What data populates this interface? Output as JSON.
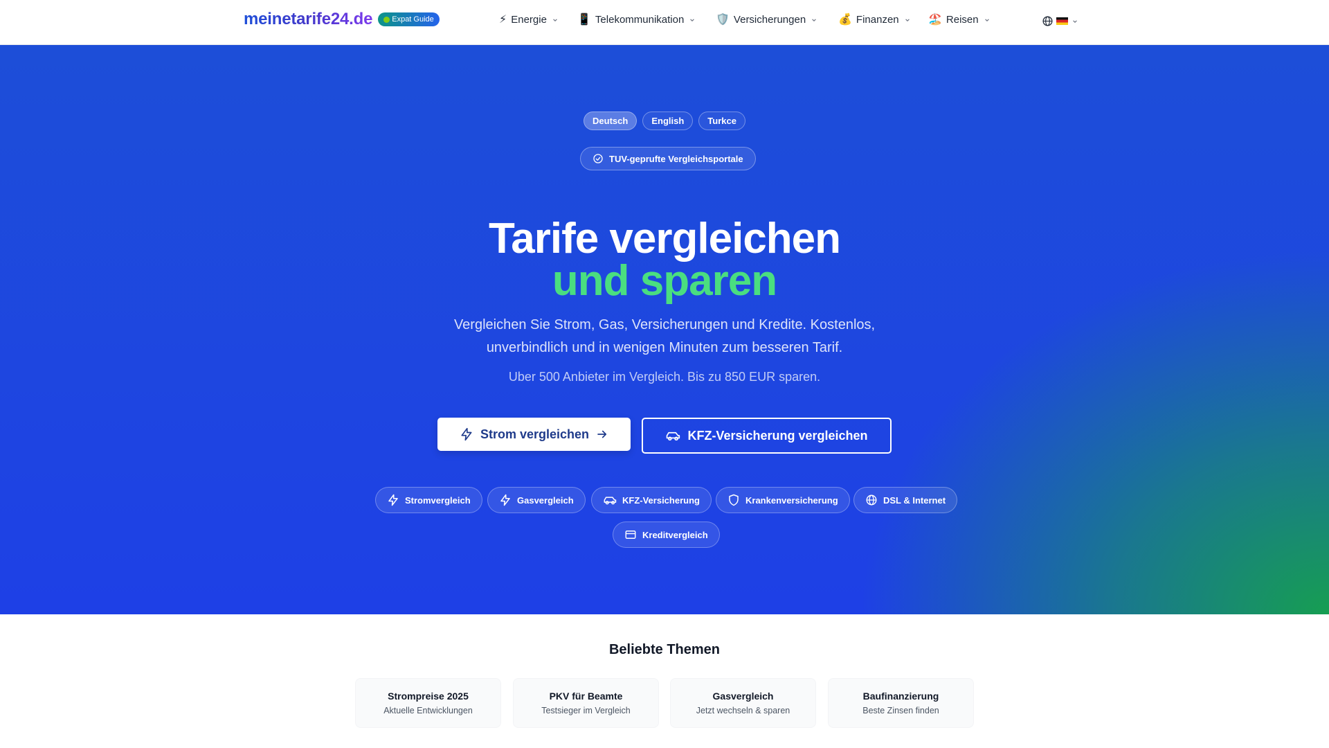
{
  "header": {
    "brand": "meinetarife24.de",
    "badge": "Expat Guide",
    "nav": [
      {
        "icon": "⚡",
        "label": "Energie"
      },
      {
        "icon": "📱",
        "label": "Telekommunikation"
      },
      {
        "icon": "🛡️",
        "label": "Versicherungen"
      },
      {
        "icon": "💰",
        "label": "Finanzen"
      },
      {
        "icon": "🏖️",
        "label": "Reisen"
      }
    ],
    "language_icon": "globe-icon"
  },
  "hero": {
    "languages": [
      "Deutsch",
      "English",
      "Turkce"
    ],
    "active_language": "Deutsch",
    "trust_badge": "TUV-geprufte Vergleichsportale",
    "headline_1": "Tarife vergleichen",
    "headline_2": "und sparen",
    "subtitle": "Vergleichen Sie Strom, Gas, Versicherungen und Kredite. Kostenlos, unverbindlich und in wenigen Minuten zum besseren Tarif.",
    "subtitle_2": "Uber 500 Anbieter im Vergleich. Bis zu 850 EUR sparen.",
    "cta_primary": "Strom vergleichen",
    "cta_secondary": "KFZ-Versicherung vergleichen",
    "chips": [
      {
        "icon": "bolt-icon",
        "label": "Stromvergleich"
      },
      {
        "icon": "bolt-icon",
        "label": "Gasvergleich"
      },
      {
        "icon": "car-icon",
        "label": "KFZ-Versicherung"
      },
      {
        "icon": "shield-icon",
        "label": "Krankenversicherung"
      },
      {
        "icon": "globe-icon",
        "label": "DSL & Internet"
      },
      {
        "icon": "credit-card-icon",
        "label": "Kreditvergleich"
      }
    ]
  },
  "topics": {
    "title": "Beliebte Themen",
    "cards": [
      {
        "title": "Strompreise 2025",
        "subtitle": "Aktuelle Entwicklungen"
      },
      {
        "title": "PKV für Beamte",
        "subtitle": "Testsieger im Vergleich"
      },
      {
        "title": "Gasvergleich",
        "subtitle": "Jetzt wechseln & sparen"
      },
      {
        "title": "Baufinanzierung",
        "subtitle": "Beste Zinsen finden"
      }
    ]
  },
  "colors": {
    "hero_blue": "#1d4ed8",
    "hero_green": "#16a34a",
    "accent_green_text": "#4ade80",
    "brand_gradient_start": "#1d4ed8",
    "brand_gradient_end": "#7c3aed"
  }
}
